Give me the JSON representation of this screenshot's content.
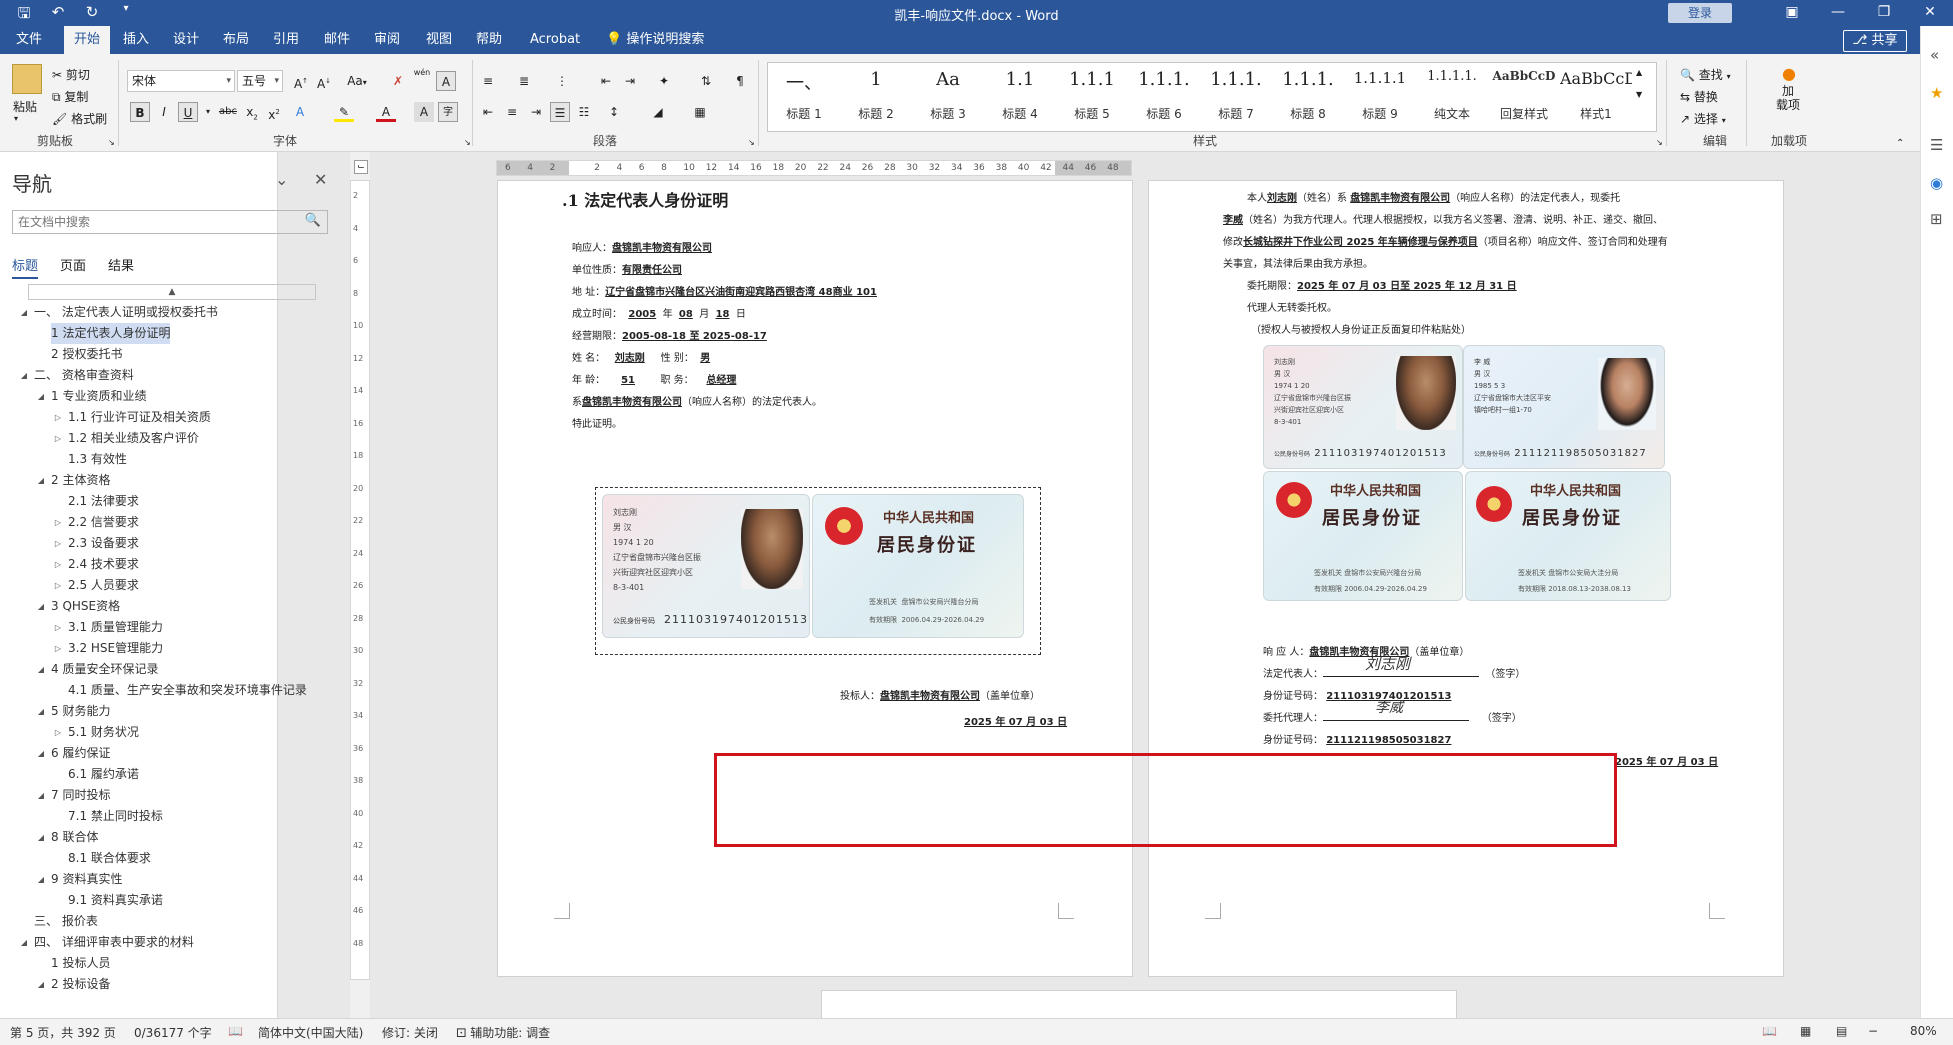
{
  "titlebar": {
    "doc_title": "凯丰-响应文件.docx  -  Word",
    "login": "登录",
    "qat_icons": [
      "save-icon",
      "undo-icon",
      "redo-icon",
      "customize-icon"
    ],
    "window_buttons": [
      "ribbon-display-icon",
      "minimize-icon",
      "restore-icon",
      "close-icon"
    ]
  },
  "menu": {
    "tabs": [
      "文件",
      "开始",
      "插入",
      "设计",
      "布局",
      "引用",
      "邮件",
      "审阅",
      "视图",
      "帮助",
      "Acrobat"
    ],
    "active": "开始",
    "tell_me": "操作说明搜索",
    "share": "共享"
  },
  "ribbon": {
    "clipboard": {
      "paste": "粘贴",
      "cut": "剪切",
      "copy": "复制",
      "format_painter": "格式刷",
      "label": "剪贴板"
    },
    "font": {
      "name": "宋体",
      "size": "五号",
      "label": "字体",
      "aa": "Aa",
      "wen": "wén"
    },
    "paragraph": {
      "label": "段落"
    },
    "styles": {
      "label": "样式",
      "items": [
        {
          "preview": "一、",
          "label": "标题 1"
        },
        {
          "preview": "1",
          "label": "标题 2"
        },
        {
          "preview": "Aa",
          "label": "标题 3"
        },
        {
          "preview": "1.1",
          "label": "标题 4"
        },
        {
          "preview": "1.1.1",
          "label": "标题 5"
        },
        {
          "preview": "1.1.1.",
          "label": "标题 6"
        },
        {
          "preview": "1.1.1.",
          "label": "标题 7"
        },
        {
          "preview": "1.1.1.",
          "label": "标题 8"
        },
        {
          "preview": "1.1.1.1",
          "label": "标题 9"
        },
        {
          "preview": "1.1.1.1.",
          "label": "纯文本"
        },
        {
          "preview": "AaBbCcD",
          "label": "回复样式"
        },
        {
          "preview": "AaBbCcD",
          "label": "样式1"
        },
        {
          "preview": "AaBbC",
          "label": ""
        }
      ]
    },
    "editing": {
      "find": "查找",
      "replace": "替换",
      "select": "选择",
      "label": "编辑"
    },
    "addin": {
      "button": "加\n载项",
      "label": "加载项"
    }
  },
  "nav": {
    "title": "导航",
    "search_placeholder": "在文档中搜索",
    "tabs": [
      "标题",
      "页面",
      "结果"
    ],
    "items": [
      {
        "text": "一、 法定代表人证明或授权委托书",
        "level": 0,
        "toggle": "open"
      },
      {
        "text": "1 法定代表人身份证明",
        "level": 1,
        "toggle": "none",
        "selected": true
      },
      {
        "text": "2 授权委托书",
        "level": 1,
        "toggle": "none"
      },
      {
        "text": "二、 资格审查资料",
        "level": 0,
        "toggle": "open"
      },
      {
        "text": "1 专业资质和业绩",
        "level": 1,
        "toggle": "open"
      },
      {
        "text": "1.1 行业许可证及相关资质",
        "level": 2,
        "toggle": "closed"
      },
      {
        "text": "1.2 相关业绩及客户评价",
        "level": 2,
        "toggle": "closed"
      },
      {
        "text": "1.3 有效性",
        "level": 2,
        "toggle": "none"
      },
      {
        "text": "2 主体资格",
        "level": 1,
        "toggle": "open"
      },
      {
        "text": "2.1 法律要求",
        "level": 2,
        "toggle": "none"
      },
      {
        "text": "2.2 信誉要求",
        "level": 2,
        "toggle": "closed"
      },
      {
        "text": "2.3 设备要求",
        "level": 2,
        "toggle": "closed"
      },
      {
        "text": "2.4 技术要求",
        "level": 2,
        "toggle": "closed"
      },
      {
        "text": "2.5 人员要求",
        "level": 2,
        "toggle": "closed"
      },
      {
        "text": "3 QHSE资格",
        "level": 1,
        "toggle": "open"
      },
      {
        "text": "3.1 质量管理能力",
        "level": 2,
        "toggle": "closed"
      },
      {
        "text": "3.2 HSE管理能力",
        "level": 2,
        "toggle": "closed"
      },
      {
        "text": "4 质量安全环保记录",
        "level": 1,
        "toggle": "open"
      },
      {
        "text": "4.1 质量、生产安全事故和突发环境事件记录",
        "level": 2,
        "toggle": "none"
      },
      {
        "text": "5 财务能力",
        "level": 1,
        "toggle": "open"
      },
      {
        "text": "5.1 财务状况",
        "level": 2,
        "toggle": "closed"
      },
      {
        "text": "6 履约保证",
        "level": 1,
        "toggle": "open"
      },
      {
        "text": "6.1 履约承诺",
        "level": 2,
        "toggle": "none"
      },
      {
        "text": "7 同时投标",
        "level": 1,
        "toggle": "open"
      },
      {
        "text": "7.1 禁止同时投标",
        "level": 2,
        "toggle": "none"
      },
      {
        "text": "8 联合体",
        "level": 1,
        "toggle": "open"
      },
      {
        "text": "8.1 联合体要求",
        "level": 2,
        "toggle": "none"
      },
      {
        "text": "9 资料真实性",
        "level": 1,
        "toggle": "open"
      },
      {
        "text": "9.1 资料真实承诺",
        "level": 2,
        "toggle": "none"
      },
      {
        "text": "三、 报价表",
        "level": 0,
        "toggle": "none"
      },
      {
        "text": "四、 详细评审表中要求的材料",
        "level": 0,
        "toggle": "open"
      },
      {
        "text": "1 投标人员",
        "level": 1,
        "toggle": "none"
      },
      {
        "text": "2 投标设备",
        "level": 1,
        "toggle": "open"
      }
    ]
  },
  "ruler": {
    "h_ticks": [
      "6",
      "4",
      "2",
      "",
      "2",
      "4",
      "6",
      "8",
      "10",
      "12",
      "14",
      "16",
      "18",
      "20",
      "22",
      "24",
      "26",
      "28",
      "30",
      "32",
      "34",
      "36",
      "38",
      "40",
      "42",
      "44",
      "46",
      "48"
    ],
    "v_ticks": [
      "2",
      "4",
      "6",
      "8",
      "10",
      "12",
      "14",
      "16",
      "18",
      "20",
      "22",
      "24",
      "26",
      "28",
      "30",
      "32",
      "34",
      "36",
      "38",
      "40",
      "42",
      "44",
      "46",
      "48"
    ]
  },
  "page1": {
    "heading": ".1  法定代表人身份证明",
    "lines": [
      {
        "label": "响应人：",
        "value": "盘锦凯丰物资有限公司"
      },
      {
        "label": "单位性质：",
        "value": "有限责任公司"
      },
      {
        "label": "地      址：",
        "value": "辽宁省盘锦市兴隆台区兴油街南迎宾路西银杏湾 48商业 101"
      },
      {
        "label": "成立时间：",
        "value": "2005",
        "value2": "08",
        "value3": "18",
        "u1": "年",
        "u2": "月",
        "u3": "日"
      },
      {
        "label": "经营期限：",
        "value": "2005-08-18 至 2025-08-17"
      },
      {
        "label": "姓      名：",
        "value": "刘志刚",
        "label2": "性      别：",
        "value2": "男"
      },
      {
        "label": "年      龄：",
        "value": "51",
        "label2": "职      务：",
        "value2": "总经理"
      },
      {
        "label": "系",
        "value": "盘锦凯丰物资有限公司",
        "suffix": "（响应人名称）的法定代表人。"
      },
      {
        "label": "特此证明。",
        "value": ""
      }
    ],
    "id_front": {
      "name": "刘志刚",
      "sex_nation": "男     汉",
      "birth": "1974    1    20",
      "addr1": "辽宁省盘锦市兴隆台区振",
      "addr2": "兴街迎宾社区迎宾小区",
      "addr3": "8-3-401",
      "id_label": "公民身份号码",
      "id_number": "211103197401201513"
    },
    "id_back": {
      "country": "中华人民共和国",
      "doc": "居民身份证",
      "authority_label": "签发机关",
      "authority": "盘锦市公安局兴隆台分局",
      "valid_label": "有效期限",
      "valid": "2006.04.29-2026.04.29"
    },
    "bidder_label": "投标人：",
    "bidder": "盘锦凯丰物资有限公司",
    "seal": "（盖单位章）",
    "date": "2025 年 07 月 03 日"
  },
  "page2": {
    "intro1_pre": "本人",
    "intro1_name": "刘志刚",
    "intro1_mid": "（姓名）系",
    "intro1_company": "盘锦凯丰物资有限公司",
    "intro1_post": "（响应人名称）的法定代表人，现委托",
    "intro2_name": "李威",
    "intro2_post": "（姓名）为我方代理人。代理人根据授权，以我方名义签署、澄清、说明、补正、递交、撤回、",
    "intro3_pre": "修改",
    "intro3_project": "长城钻探井下作业公司 2025 年车辆修理与保养项目",
    "intro3_post": "（项目名称）响应文件、签订合同和处理有",
    "intro4": "关事宜，其法律后果由我方承担。",
    "term_label": "委托期限：",
    "term": "2025 年 07 月 03 日至 2025 年 12 月 31 日",
    "no_sub": "代理人无转委托权。",
    "attach_note": "（授权人与被授权人身份证正反面复印件粘贴处）",
    "card_a": {
      "name": "刘志刚",
      "sex_nation": "男     汉",
      "birth": "1974   1   20",
      "addr1": "辽宁省盘锦市兴隆台区振",
      "addr2": "兴街迎宾社区迎宾小区",
      "addr3": "8-3-401",
      "id_label": "公民身份号码",
      "id_number": "211103197401201513"
    },
    "card_b": {
      "name": "李  威",
      "sex_nation": "男     汉",
      "birth": "1985   5   3",
      "addr1": "辽宁省盘锦市大洼区平安",
      "addr2": "镇哈吧村一组1-70",
      "id_label": "公民身份号码",
      "id_number": "211121198505031827"
    },
    "back_a": {
      "country": "中华人民共和国",
      "doc": "居民身份证",
      "authority_label": "签发机关",
      "authority": "盘锦市公安局兴隆台分局",
      "valid_label": "有效期限",
      "valid": "2006.04.29-2026.04.29"
    },
    "back_b": {
      "country": "中华人民共和国",
      "doc": "居民身份证",
      "authority_label": "签发机关",
      "authority": "盘锦市公安局大洼分局",
      "valid_label": "有效期限",
      "valid": "2018.08.13-2038.08.13"
    },
    "resp_label": "响      应      人：",
    "resp": "盘锦凯丰物资有限公司",
    "resp_seal": "（盖单位章）",
    "legal_label": "法定代表人：",
    "legal_sig": "刘志刚",
    "sign": "（签字）",
    "id1_label": "身份证号码：",
    "id1": "211103197401201513",
    "agent_label": "委托代理人：",
    "agent_sig": "李威",
    "id2_label": "身份证号码：",
    "id2": "211121198505031827",
    "date": "2025 年 07 月 03 日"
  },
  "status": {
    "page": "第 5 页，共 392 页",
    "words": "0/36177 个字",
    "lang": "简体中文(中国大陆)",
    "track": "修订: 关闭",
    "access": "辅助功能: 调查",
    "zoom": "80%"
  },
  "colors": {
    "accent": "#2b579a",
    "highlight": "#d0121b",
    "selection": "#cfdcf1"
  }
}
